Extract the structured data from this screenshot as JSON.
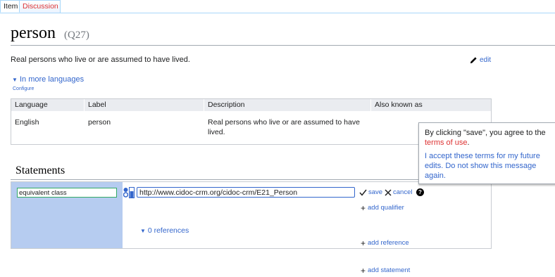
{
  "tabs": {
    "item": "Item",
    "discussion": "Discussion"
  },
  "entity": {
    "label": "person",
    "id": "(Q27)",
    "description": "Real persons who live or are assumed to have lived.",
    "edit_label": "edit"
  },
  "languages": {
    "toggle_label": "In more languages",
    "configure_label": "Configure",
    "headers": [
      "Language",
      "Label",
      "Description",
      "Also known as"
    ],
    "rows": [
      {
        "language": "English",
        "label": "person",
        "description": "Real persons who live or are assumed to have lived.",
        "aliases": ""
      }
    ]
  },
  "statements": {
    "title": "Statements",
    "property_value": "equivalent class",
    "value_input": "http://www.cidoc-crm.org/cidoc-crm/E21_Person",
    "save_label": "save",
    "cancel_label": "cancel",
    "add_qualifier_label": "add qualifier",
    "references_label": "0 references",
    "add_reference_label": "add reference",
    "add_statement_label": "add statement"
  },
  "tooltip": {
    "text_before": "By clicking \"save\", you agree to the",
    "terms_link": "terms of use",
    "text_after": ".",
    "accept_label": "I accept these terms for my future edits. Do not show this message again."
  }
}
